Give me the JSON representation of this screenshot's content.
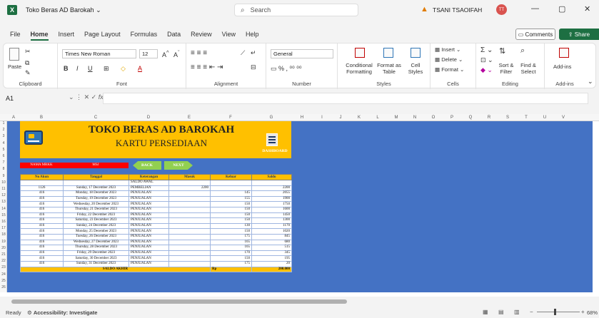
{
  "app": {
    "logo": "X",
    "doc_title": "Toko Beras AD Barokah",
    "search_placeholder": "Search",
    "user_name": "TSANI TSAOIFAH",
    "user_initials": "TT",
    "minimize": "—",
    "restore": "▢",
    "close": "✕"
  },
  "menu": {
    "tabs": [
      "File",
      "Home",
      "Insert",
      "Page Layout",
      "Formulas",
      "Data",
      "Review",
      "View",
      "Help"
    ],
    "comments": "Comments",
    "share": "Share"
  },
  "ribbon": {
    "clipboard": {
      "label": "Clipboard",
      "paste": "Paste"
    },
    "font": {
      "label": "Font",
      "family": "Times New Roman",
      "size": "12",
      "bold": "B",
      "italic": "I",
      "underline": "U"
    },
    "alignment": {
      "label": "Alignment"
    },
    "number": {
      "label": "Number",
      "format": "General"
    },
    "styles": {
      "label": "Styles",
      "conditional": "Conditional\nFormatting",
      "format_table": "Format as\nTable",
      "cell_styles": "Cell\nStyles"
    },
    "cells": {
      "label": "Cells",
      "insert": "Insert",
      "delete": "Delete",
      "format": "Format"
    },
    "editing": {
      "label": "Editing",
      "sort": "Sort &\nFilter",
      "find": "Find &\nSelect"
    },
    "addins": {
      "label": "Add-ins",
      "addins": "Add-ins"
    }
  },
  "formula_bar": {
    "cell_ref": "A1",
    "fx": "fx",
    "value": ""
  },
  "columns": [
    "A",
    "B",
    "C",
    "D",
    "E",
    "F",
    "G",
    "H",
    "I",
    "J",
    "K",
    "L",
    "M",
    "N",
    "O",
    "P",
    "Q",
    "R",
    "S",
    "T",
    "U",
    "V"
  ],
  "rows": [
    "1",
    "2",
    "3",
    "4",
    "5",
    "6",
    "7",
    "8",
    "9",
    "10",
    "11",
    "12",
    "13",
    "14",
    "15",
    "16",
    "17",
    "18",
    "19",
    "20",
    "21",
    "22",
    "23",
    "24",
    "25",
    "26"
  ],
  "sheet": {
    "title": "TOKO BERAS AD BAROKAH",
    "subtitle": "KARTU PERSEDIAAN",
    "dashboard_label": "DASHBOARD",
    "nama_mrk_label": "NAMA MRKK",
    "nama_mrk_value": "MSJ",
    "back": "BACK",
    "next": "NEXT",
    "headers": [
      "No Akun",
      "Tanggal",
      "Keterangan",
      "Masuk",
      "Keluar",
      "Saldo"
    ],
    "saldo_awal": "SALDO AWAL",
    "rows": [
      {
        "akun": "1126",
        "tanggal": "Sunday, 17 December 2023",
        "ket": "PEMBELIAN",
        "masuk": "2200",
        "keluar": "",
        "saldo": "2200"
      },
      {
        "akun": "416",
        "tanggal": "Monday, 18 December 2023",
        "ket": "PENJUALAN",
        "masuk": "",
        "keluar": "145",
        "saldo": "2055"
      },
      {
        "akun": "416",
        "tanggal": "Tuesday, 19 December 2023",
        "ket": "PENJUALAN",
        "masuk": "",
        "keluar": "155",
        "saldo": "1900"
      },
      {
        "akun": "416",
        "tanggal": "Wednesday, 20 December 2023",
        "ket": "PENJUALAN",
        "masuk": "",
        "keluar": "150",
        "saldo": "1750"
      },
      {
        "akun": "416",
        "tanggal": "Thursday, 21 December 2023",
        "ket": "PENJUALAN",
        "masuk": "",
        "keluar": "150",
        "saldo": "1600"
      },
      {
        "akun": "416",
        "tanggal": "Friday, 22 December 2023",
        "ket": "PENJUALAN",
        "masuk": "",
        "keluar": "150",
        "saldo": "1450"
      },
      {
        "akun": "416",
        "tanggal": "Saturday, 23 December 2023",
        "ket": "PENJUALAN",
        "masuk": "",
        "keluar": "150",
        "saldo": "1300"
      },
      {
        "akun": "416",
        "tanggal": "Sunday, 24 December 2023",
        "ket": "PENJUALAN",
        "masuk": "",
        "keluar": "130",
        "saldo": "1170"
      },
      {
        "akun": "416",
        "tanggal": "Monday, 25 December 2023",
        "ket": "PENJUALAN",
        "masuk": "",
        "keluar": "150",
        "saldo": "1020"
      },
      {
        "akun": "416",
        "tanggal": "Tuesday, 26 December 2023",
        "ket": "PENJUALAN",
        "masuk": "",
        "keluar": "175",
        "saldo": "845"
      },
      {
        "akun": "416",
        "tanggal": "Wednesday, 27 December 2023",
        "ket": "PENJUALAN",
        "masuk": "",
        "keluar": "165",
        "saldo": "680"
      },
      {
        "akun": "416",
        "tanggal": "Thursday, 28 December 2023",
        "ket": "PENJUALAN",
        "masuk": "",
        "keluar": "165",
        "saldo": "515"
      },
      {
        "akun": "416",
        "tanggal": "Friday, 29 December 2023",
        "ket": "PENJUALAN",
        "masuk": "",
        "keluar": "170",
        "saldo": "345"
      },
      {
        "akun": "416",
        "tanggal": "Saturday, 30 December 2023",
        "ket": "PENJUALAN",
        "masuk": "",
        "keluar": "150",
        "saldo": "195"
      },
      {
        "akun": "416",
        "tanggal": "Sunday, 31 December 2023",
        "ket": "PENJUALAN",
        "masuk": "",
        "keluar": "175",
        "saldo": "20"
      }
    ],
    "saldo_akhir": "SALDO AKHIR",
    "saldo_akhir_currency": "Rp",
    "saldo_akhir_value": "200.000"
  },
  "status": {
    "ready": "Ready",
    "accessibility": "Accessibility: Investigate",
    "zoom": "68%"
  },
  "colors": {
    "excel_green": "#1d6f42",
    "sheet_blue": "#4472c4",
    "banner_yellow": "#ffc000",
    "button_green": "#92d050",
    "label_red": "#ff0000"
  }
}
